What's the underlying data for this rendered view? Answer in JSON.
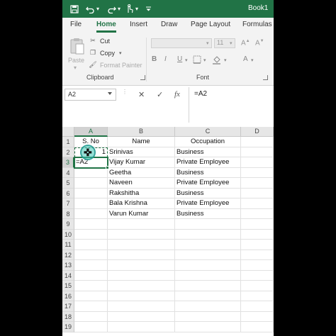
{
  "titlebar": {
    "book_title": "Book1",
    "quick_access": [
      {
        "name": "save-icon",
        "glyph": "🖫"
      },
      {
        "name": "undo-icon",
        "glyph": "↶"
      },
      {
        "name": "undo-dropdown-icon",
        "glyph": "▾"
      },
      {
        "name": "redo-icon",
        "glyph": "↷"
      },
      {
        "name": "redo-dropdown-icon",
        "glyph": "▾"
      },
      {
        "name": "touch-mode-icon",
        "glyph": "☝"
      },
      {
        "name": "touch-dropdown-icon",
        "glyph": "▾"
      },
      {
        "name": "customize-qat-icon",
        "glyph": "⩡"
      }
    ],
    "bg_color": "#217346"
  },
  "tabs": [
    "File",
    "Home",
    "Insert",
    "Draw",
    "Page Layout",
    "Formulas"
  ],
  "active_tab": "Home",
  "clipboard": {
    "paste_label": "Paste",
    "cut_label": "Cut",
    "copy_label": "Copy",
    "format_painter_label": "Format Painter",
    "group_label": "Clipboard"
  },
  "font_group": {
    "font_size": "11",
    "group_label": "Font",
    "bold": "B",
    "italic": "I",
    "underline": "U"
  },
  "formula_bar": {
    "name_box": "A2",
    "cancel": "✕",
    "enter": "✓",
    "fx": "fx",
    "formula": "=A2"
  },
  "columns": [
    "A",
    "B",
    "C",
    "D"
  ],
  "rows": [
    "1",
    "2",
    "3",
    "4",
    "5",
    "6",
    "7",
    "8",
    "9",
    "10",
    "11",
    "12",
    "13",
    "14",
    "15",
    "16",
    "17",
    "18",
    "19"
  ],
  "cells": {
    "header_sno": "S. No",
    "header_name": "Name",
    "header_occupation": "Occupation",
    "a2_value": "1",
    "a3_edit": "=A2",
    "names": [
      "Srinivas",
      "Vijay Kumar",
      "Geetha",
      "Naveen",
      "Rakshitha",
      "Bala Krishna",
      "Varun Kumar"
    ],
    "occupations": [
      "Business",
      "Private Employee",
      "Business",
      "Private Employee",
      "Business",
      "Private Employee",
      "Business"
    ]
  },
  "accent_color": "#217346"
}
